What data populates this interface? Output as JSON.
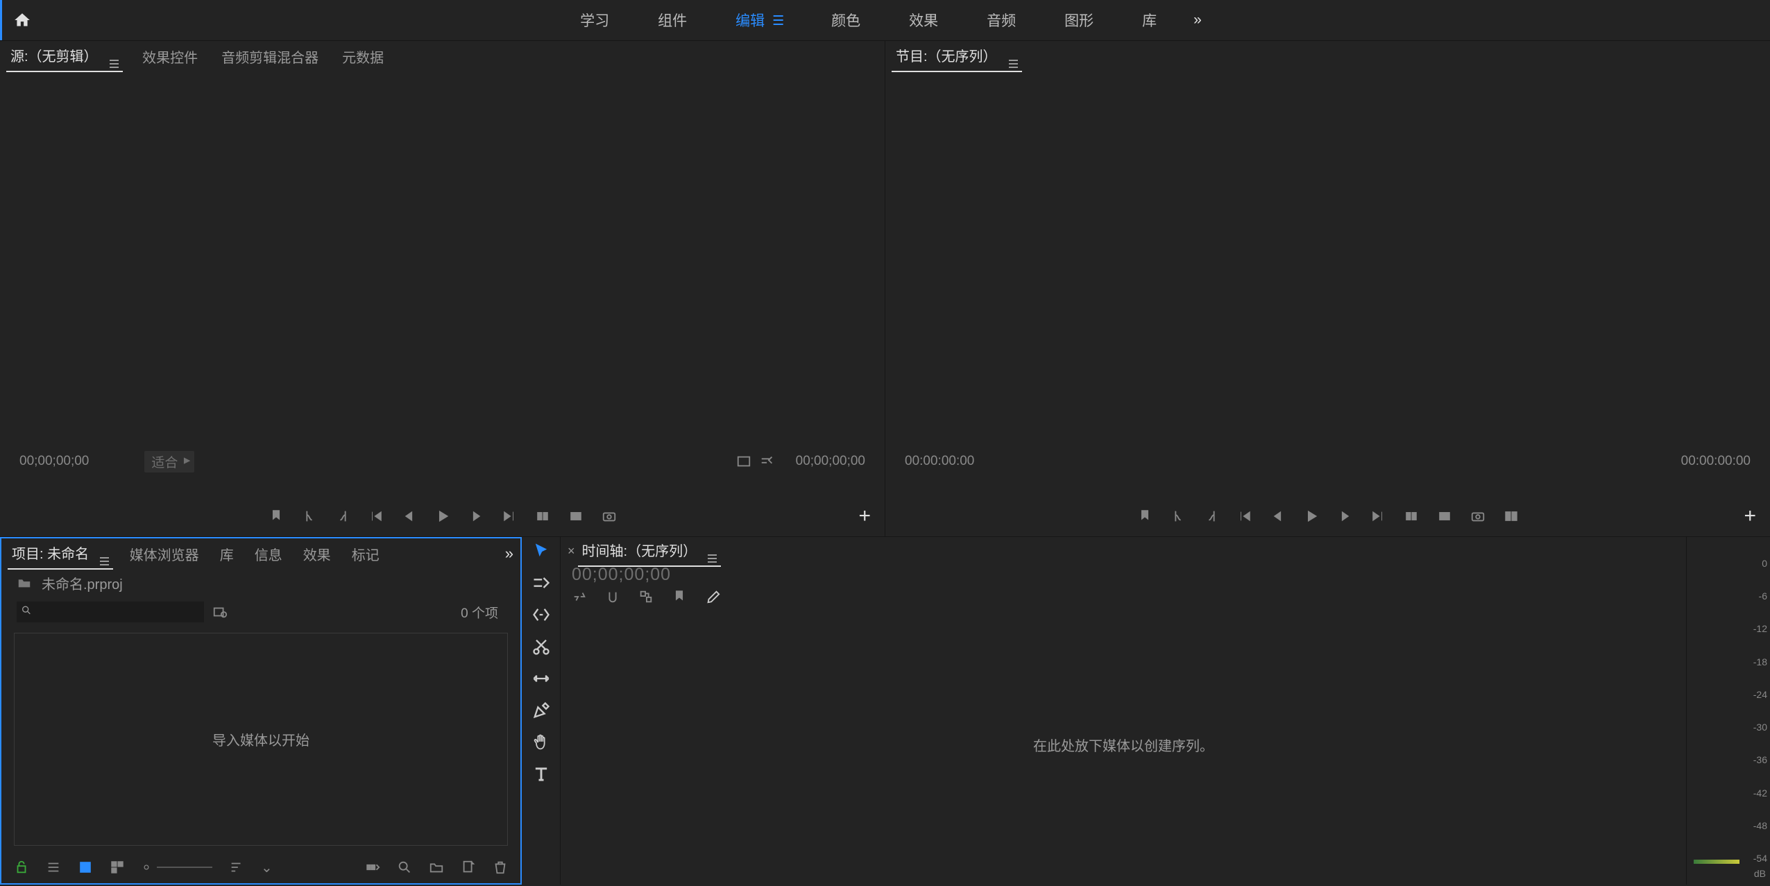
{
  "workspaces": {
    "learn": "学习",
    "assembly": "组件",
    "editing": "编辑",
    "color": "颜色",
    "effects": "效果",
    "audio": "音频",
    "graphics": "图形",
    "library": "库"
  },
  "source_panel": {
    "tabs": {
      "source": "源:（无剪辑）",
      "effect_controls": "效果控件",
      "audio_clip_mixer": "音频剪辑混合器",
      "metadata": "元数据"
    },
    "tc_in": "00;00;00;00",
    "fit_label": "适合",
    "tc_out": "00;00;00;00"
  },
  "program_panel": {
    "tab": "节目:（无序列）",
    "tc_in": "00:00:00:00",
    "tc_out": "00:00:00:00"
  },
  "project_panel": {
    "tabs": {
      "project": "项目: 未命名",
      "media_browser": "媒体浏览器",
      "library": "库",
      "info": "信息",
      "effects": "效果",
      "markers": "标记"
    },
    "file_name": "未命名.prproj",
    "item_count": "0 个项",
    "drop_hint": "导入媒体以开始"
  },
  "timeline_panel": {
    "tab": "时间轴:（无序列）",
    "timecode": "00;00;00;00",
    "drop_hint": "在此处放下媒体以创建序列。"
  },
  "audio_meter": {
    "ticks": [
      "0",
      "-6",
      "-12",
      "-18",
      "-24",
      "-30",
      "-36",
      "-42",
      "-48",
      "-54"
    ],
    "db_label": "dB"
  }
}
